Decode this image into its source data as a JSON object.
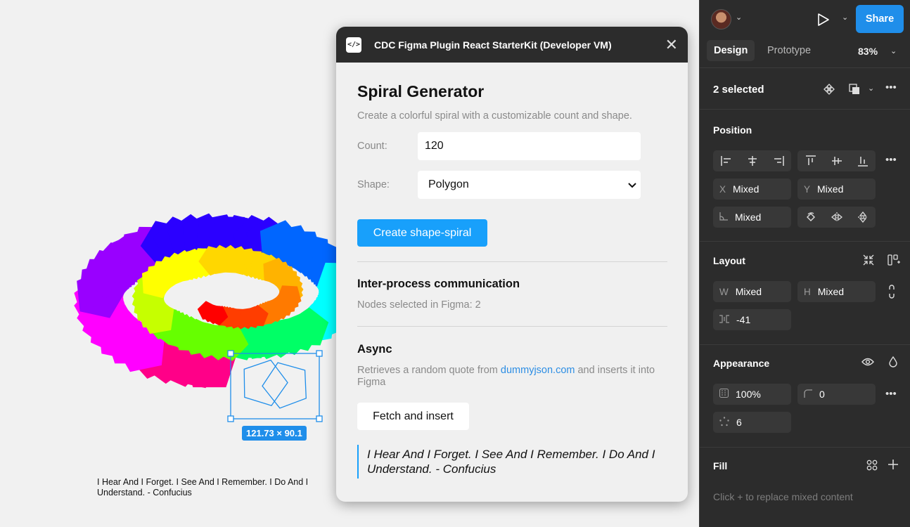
{
  "canvas": {
    "caption": "I Hear And I Forget. I See And I Remember. I Do And I Understand. - Confucius",
    "dimension_badge": "121.73 × 90.1"
  },
  "plugin": {
    "title": "CDC Figma Plugin React StarterKit (Developer VM)",
    "heading": "Spiral Generator",
    "subtitle": "Create a colorful spiral with a customizable count and shape.",
    "count_label": "Count:",
    "count_value": "120",
    "shape_label": "Shape:",
    "shape_value": "Polygon",
    "create_button": "Create shape-spiral",
    "ipc_heading": "Inter-process communication",
    "ipc_text": "Nodes selected in Figma: 2",
    "async_heading": "Async",
    "async_text_before": "Retrieves a random quote from ",
    "async_link": "dummyjson.com",
    "async_text_after": " and inserts it into Figma",
    "fetch_button": "Fetch and insert",
    "quote": "I Hear And I Forget. I See And I Remember. I Do And I Understand. - Confucius"
  },
  "panel": {
    "share": "Share",
    "tabs": [
      "Design",
      "Prototype"
    ],
    "zoom": "83%",
    "selection": "2 selected",
    "position": {
      "title": "Position",
      "x_label": "X",
      "x_value": "Mixed",
      "y_label": "Y",
      "y_value": "Mixed",
      "rotation_value": "Mixed"
    },
    "layout": {
      "title": "Layout",
      "w_label": "W",
      "w_value": "Mixed",
      "h_label": "H",
      "h_value": "Mixed",
      "gap_value": "-41"
    },
    "appearance": {
      "title": "Appearance",
      "opacity": "100%",
      "radius": "0",
      "count": "6"
    },
    "fill": {
      "title": "Fill",
      "placeholder": "Click + to replace mixed content"
    }
  },
  "colors": {
    "accent": "#18a0fb",
    "panel_bg": "#2c2c2c",
    "share_bg": "#1f8eea",
    "spiral": [
      "#ff0000",
      "#ff3d00",
      "#ff7a00",
      "#ffb300",
      "#ffd700",
      "#ffff00",
      "#c6ff00",
      "#66ff00",
      "#00ff66",
      "#00ffff",
      "#0066ff",
      "#2b00ff",
      "#9900ff",
      "#ff00ff",
      "#ff0088"
    ]
  }
}
